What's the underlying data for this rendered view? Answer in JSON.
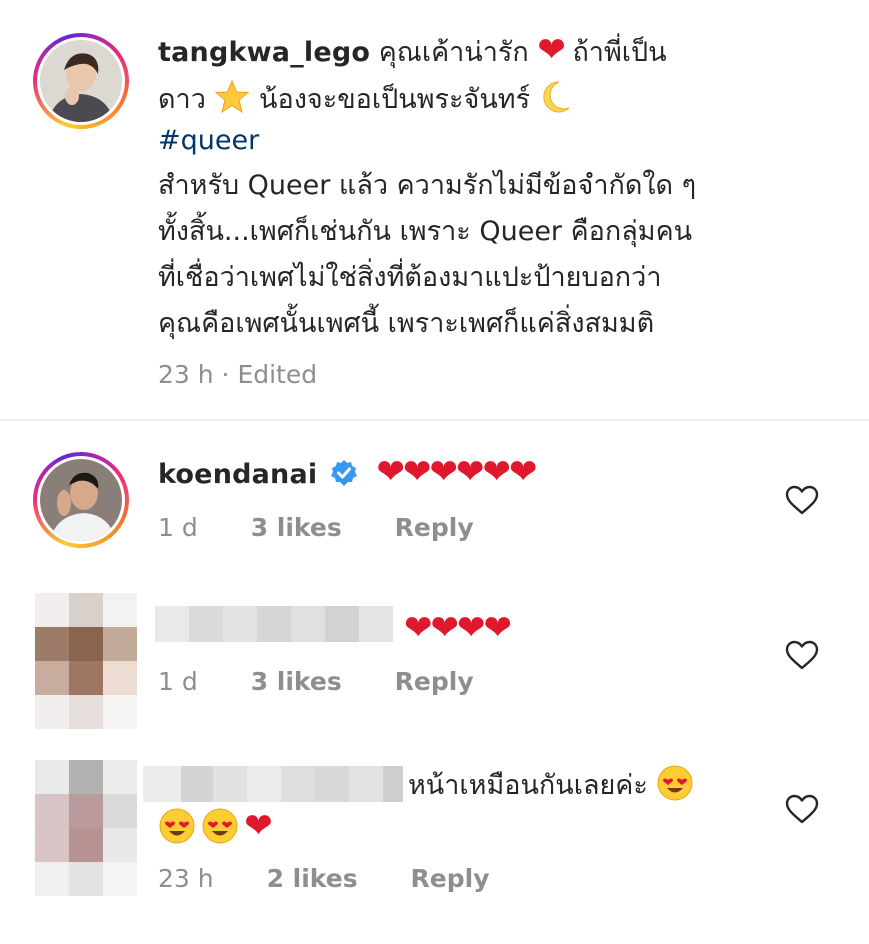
{
  "caption": {
    "username": "tangkwa_lego",
    "line1_text": "คุณเค้าน่ารัก",
    "line1_end": "ถ้าพี่เป็น",
    "line2_start": "ดาว",
    "line2_end": "น้องจะขอเป็นพระจันทร์",
    "hashtag": "#queer",
    "body_lines": [
      "สำหรับ Queer แล้ว ความรักไม่มีข้อจำกัดใด ๆ",
      "ทั้งสิ้น...เพศก็เช่นกัน เพราะ Queer คือกลุ่มคน",
      "ที่เชื่อว่าเพศไม่ใช่สิ่งที่ต้องมาแปะป้ายบอกว่า",
      "คุณคือเพศนั้นเพศนี้ เพราะเพศก็แค่สิ่งสมมติ"
    ],
    "meta": "23 h · Edited"
  },
  "comments": [
    {
      "username": "koendanai",
      "text": "❤❤❤❤❤❤",
      "time": "1 d",
      "likes": "3 likes",
      "reply": "Reply"
    },
    {
      "text": "❤❤❤❤",
      "time": "1 d",
      "likes": "3 likes",
      "reply": "Reply"
    },
    {
      "text": "หน้าเหมือนกันเลยค่ะ",
      "time": "23 h",
      "likes": "2 likes",
      "reply": "Reply"
    }
  ],
  "colors": {
    "heart": "#e0182d",
    "verified": "#3897f0",
    "hashtag": "#00376b",
    "meta": "#8e8e8e"
  },
  "icons": [
    "heart-outline-icon",
    "verified-badge-icon",
    "star-emoji-icon",
    "crescent-moon-emoji-icon",
    "heart-eyes-emoji-icon"
  ]
}
